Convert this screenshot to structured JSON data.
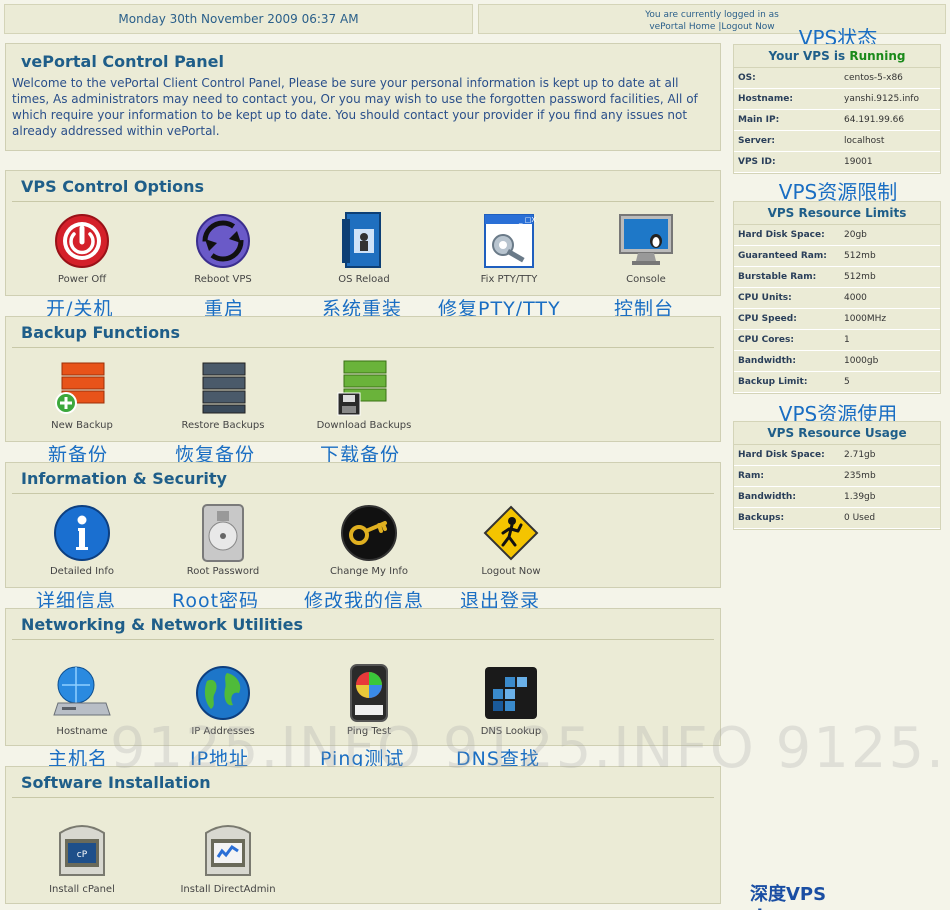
{
  "topbar": {
    "date": "Monday 30th November 2009 06:37 AM",
    "login_line": "You are currently logged in as",
    "home_link": "vePortal Home",
    "logout_link": "|Logout Now"
  },
  "control_panel": {
    "title": "vePortal Control Panel",
    "intro": "Welcome to the vePortal Client Control Panel, Please be sure your personal information is kept up to date at all times, As administrators may need to contact you, Or you may wish to use the forgotten password facilities, All of which require your information to be kept up to date. You should contact your provider if you find any issues not already addressed within vePortal."
  },
  "sections": {
    "vps_control": {
      "title": "VPS Control Options",
      "items": [
        {
          "label": "Power Off",
          "cn": "开/关机",
          "icon": "power-off-icon"
        },
        {
          "label": "Reboot VPS",
          "cn": "重启",
          "icon": "reboot-icon"
        },
        {
          "label": "OS Reload",
          "cn": "系统重装",
          "icon": "os-reload-icon"
        },
        {
          "label": "Fix PTY/TTY",
          "cn": "修复PTY/TTY",
          "icon": "fix-pty-icon"
        },
        {
          "label": "Console",
          "cn": "控制台",
          "icon": "console-icon"
        }
      ]
    },
    "backup": {
      "title": "Backup Functions",
      "items": [
        {
          "label": "New Backup",
          "cn": "新备份",
          "icon": "new-backup-icon"
        },
        {
          "label": "Restore Backups",
          "cn": "恢复备份",
          "icon": "restore-backups-icon"
        },
        {
          "label": "Download Backups",
          "cn": "下载备份",
          "icon": "download-backups-icon"
        }
      ]
    },
    "info_security": {
      "title": "Information & Security",
      "items": [
        {
          "label": "Detailed Info",
          "cn": "详细信息",
          "icon": "info-icon"
        },
        {
          "label": "Root Password",
          "cn": "Root密码",
          "icon": "root-password-icon"
        },
        {
          "label": "Change My Info",
          "cn": "修改我的信息",
          "icon": "change-info-key-icon"
        },
        {
          "label": "Logout Now",
          "cn": "退出登录",
          "icon": "logout-sign-icon"
        }
      ]
    },
    "networking": {
      "title": "Networking & Network Utilities",
      "items": [
        {
          "label": "Hostname",
          "cn": "主机名",
          "icon": "hostname-icon"
        },
        {
          "label": "IP Addresses",
          "cn": "IP地址",
          "icon": "globe-icon"
        },
        {
          "label": "Ping Test",
          "cn": "Ping测试",
          "icon": "ping-test-icon"
        },
        {
          "label": "DNS Lookup",
          "cn": "DNS查找",
          "icon": "dns-lookup-icon"
        }
      ]
    },
    "software": {
      "title": "Software Installation",
      "items": [
        {
          "label": "Install cPanel",
          "icon": "cpanel-icon"
        },
        {
          "label": "Install DirectAdmin",
          "icon": "directadmin-icon"
        }
      ]
    }
  },
  "sidebar": {
    "status_annotation": "VPS状态",
    "status_title_prefix": "Your VPS is",
    "status_value": "Running",
    "status_rows": [
      {
        "k": "OS:",
        "v": "centos-5-x86"
      },
      {
        "k": "Hostname:",
        "v": "yanshi.9125.info"
      },
      {
        "k": "Main IP:",
        "v": "64.191.99.66"
      },
      {
        "k": "Server:",
        "v": "localhost"
      },
      {
        "k": "VPS ID:",
        "v": "19001"
      }
    ],
    "limits_annotation": "VPS资源限制",
    "limits_title": "VPS Resource Limits",
    "limits_rows": [
      {
        "k": "Hard Disk Space:",
        "v": "20gb"
      },
      {
        "k": "Guaranteed Ram:",
        "v": "512mb"
      },
      {
        "k": "Burstable Ram:",
        "v": "512mb"
      },
      {
        "k": "CPU Units:",
        "v": "4000"
      },
      {
        "k": "CPU Speed:",
        "v": "1000MHz"
      },
      {
        "k": "CPU Cores:",
        "v": "1"
      },
      {
        "k": "Bandwidth:",
        "v": "1000gb"
      },
      {
        "k": "Backup Limit:",
        "v": "5"
      }
    ],
    "usage_annotation": "VPS资源使用",
    "usage_title": "VPS Resource Usage",
    "usage_rows": [
      {
        "k": "Hard Disk Space:",
        "v": "2.71gb"
      },
      {
        "k": "Ram:",
        "v": "235mb"
      },
      {
        "k": "Bandwidth:",
        "v": "1.39gb"
      },
      {
        "k": "Backups:",
        "v": "0 Used"
      }
    ]
  },
  "watermark": "9125.INFO 9125.INFO 9125.INFO 9125.INFO",
  "footer_brand": "深度VPS deevps.com",
  "colors": {
    "accent": "#1f5e89",
    "running": "#1a8a1a",
    "annotation": "#1a6ec3"
  }
}
